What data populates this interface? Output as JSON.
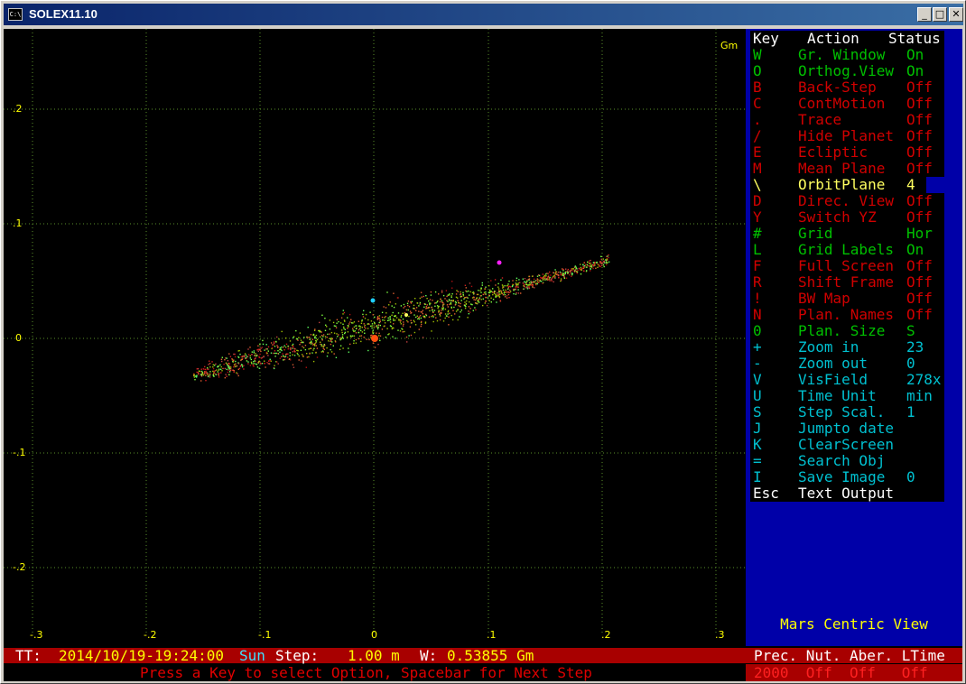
{
  "window": {
    "title": "SOLEX11.10",
    "icon": "console-icon",
    "min_label": "_",
    "max_label": "□",
    "close_label": "✕"
  },
  "plot": {
    "unit": "Gm",
    "x_ticks": [
      "-.3",
      "-.2",
      "-.1",
      "0",
      ".1",
      ".2",
      ".3"
    ],
    "y_ticks": [
      ".2",
      ".1",
      "0",
      "-.1",
      "-.2"
    ],
    "grid_color": "#5a8f2a",
    "label_color": "#ffff00"
  },
  "panel": {
    "header": {
      "key": "Key",
      "action": "Action",
      "status": "Status"
    },
    "items": [
      {
        "key": "W",
        "action": "Gr. Window",
        "status": "On",
        "color": "#00c000"
      },
      {
        "key": "O",
        "action": "Orthog.View",
        "status": "On",
        "color": "#00c000"
      },
      {
        "key": "B",
        "action": "Back-Step",
        "status": "Off",
        "color": "#d00000"
      },
      {
        "key": "C",
        "action": "ContMotion",
        "status": "Off",
        "color": "#d00000"
      },
      {
        "key": ".",
        "action": "Trace",
        "status": "Off",
        "color": "#d00000"
      },
      {
        "key": "/",
        "action": "Hide Planet",
        "status": "Off",
        "color": "#d00000"
      },
      {
        "key": "E",
        "action": "Ecliptic",
        "status": "Off",
        "color": "#d00000"
      },
      {
        "key": "M",
        "action": "Mean Plane",
        "status": "Off",
        "color": "#d00000"
      },
      {
        "key": "\\",
        "action": "OrbitPlane",
        "status": "4",
        "color": "#ffff60"
      },
      {
        "key": "D",
        "action": "Direc. View",
        "status": "Off",
        "color": "#d00000"
      },
      {
        "key": "Y",
        "action": "Switch YZ",
        "status": "Off",
        "color": "#d00000"
      },
      {
        "key": "#",
        "action": "Grid",
        "status": "Hor",
        "color": "#00c000"
      },
      {
        "key": "L",
        "action": "Grid Labels",
        "status": "On",
        "color": "#00c000"
      },
      {
        "key": "F",
        "action": "Full Screen",
        "status": "Off",
        "color": "#d00000"
      },
      {
        "key": "R",
        "action": "Shift Frame",
        "status": "Off",
        "color": "#d00000"
      },
      {
        "key": "!",
        "action": "BW Map",
        "status": "Off",
        "color": "#d00000"
      },
      {
        "key": "N",
        "action": "Plan. Names",
        "status": "Off",
        "color": "#d00000"
      },
      {
        "key": "0",
        "action": "Plan. Size",
        "status": "S",
        "color": "#00c000"
      },
      {
        "key": "+",
        "action": "Zoom in",
        "status": "23",
        "color": "#00c0d0"
      },
      {
        "key": "-",
        "action": "Zoom out",
        "status": "0",
        "color": "#00c0d0"
      },
      {
        "key": "V",
        "action": "VisField",
        "status": "278x",
        "color": "#00c0d0"
      },
      {
        "key": "U",
        "action": "Time Unit",
        "status": "min",
        "color": "#00c0d0"
      },
      {
        "key": "S",
        "action": "Step Scal.",
        "status": "1",
        "color": "#00c0d0"
      },
      {
        "key": "J",
        "action": "Jumpto date",
        "status": "",
        "color": "#00c0d0"
      },
      {
        "key": "K",
        "action": "ClearScreen",
        "status": "",
        "color": "#00c0d0"
      },
      {
        "key": "=",
        "action": "Search Obj",
        "status": "",
        "color": "#00c0d0"
      },
      {
        "key": "I",
        "action": "Save Image",
        "status": "0",
        "color": "#00c0d0"
      }
    ],
    "esc": {
      "key": "Esc",
      "action": "Text Output"
    },
    "view_label": "Mars Centric View"
  },
  "status": {
    "tt_label": "TT:",
    "datetime": "2014/10/19-19:24:00",
    "center": "Sun",
    "step_label": "Step:",
    "step_value": "1.00 m",
    "w_label": "W:",
    "w_value": "0.53855 Gm",
    "flags_header": "Prec. Nut. Aber. LTime",
    "prompt": "Press a Key to select Option, Spacebar for Next Step",
    "flags_values": "2000  Off  Off   Off"
  }
}
